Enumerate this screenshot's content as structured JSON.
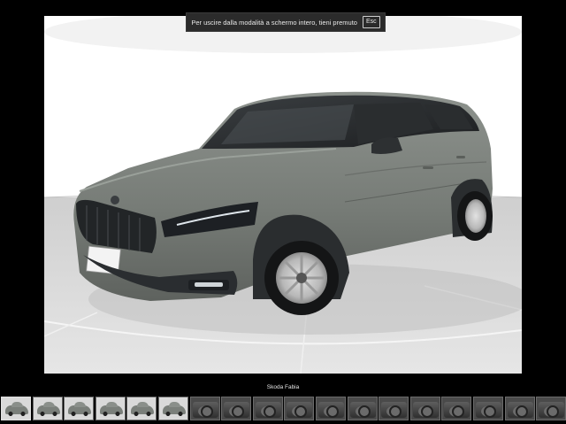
{
  "fullscreen_notice": {
    "message": "Per uscire dalla modalità a schermo intero, tieni premuto",
    "key": "Esc"
  },
  "viewer": {
    "caption": "Skoda Fabia",
    "car_color": "#7c827d"
  },
  "thumbnails": [
    {
      "kind": "exterior",
      "active": true
    },
    {
      "kind": "exterior",
      "active": false
    },
    {
      "kind": "exterior",
      "active": false
    },
    {
      "kind": "exterior",
      "active": false
    },
    {
      "kind": "exterior",
      "active": false
    },
    {
      "kind": "exterior",
      "active": false
    },
    {
      "kind": "interior",
      "active": false
    },
    {
      "kind": "interior",
      "active": false
    },
    {
      "kind": "interior",
      "active": false
    },
    {
      "kind": "interior",
      "active": false
    },
    {
      "kind": "interior",
      "active": false
    },
    {
      "kind": "interior",
      "active": false
    },
    {
      "kind": "interior",
      "active": false
    },
    {
      "kind": "interior",
      "active": false
    },
    {
      "kind": "interior",
      "active": false
    },
    {
      "kind": "interior",
      "active": false
    },
    {
      "kind": "interior",
      "active": false
    },
    {
      "kind": "interior",
      "active": false
    }
  ]
}
